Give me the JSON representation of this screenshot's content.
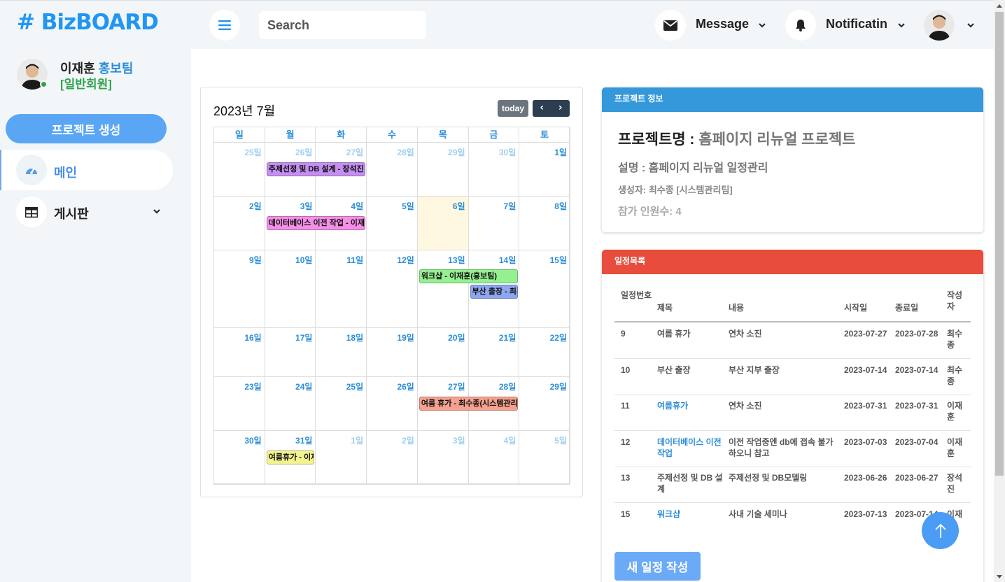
{
  "app": {
    "logo": "# BizBOARD"
  },
  "header": {
    "search_placeholder": "Search",
    "message_label": "Message",
    "notification_label": "Notificatin"
  },
  "sidebar": {
    "user_name": "이재훈",
    "user_team": "홍보팀",
    "user_role": "[일반회원]",
    "create_button": "프로젝트 생성",
    "items": [
      {
        "label": "메인",
        "icon": "gauge-icon"
      },
      {
        "label": "게시판",
        "icon": "table-icon"
      }
    ]
  },
  "calendar": {
    "title": "2023년 7월",
    "today_label": "today",
    "prev_label": "‹",
    "next_label": "›",
    "weekdays": [
      "일",
      "월",
      "화",
      "수",
      "목",
      "금",
      "토"
    ],
    "weeks": [
      [
        "25일",
        "26일",
        "27일",
        "28일",
        "29일",
        "30일",
        "1일"
      ],
      [
        "2일",
        "3일",
        "4일",
        "5일",
        "6일",
        "7일",
        "8일"
      ],
      [
        "9일",
        "10일",
        "11일",
        "12일",
        "13일",
        "14일",
        "15일"
      ],
      [
        "16일",
        "17일",
        "18일",
        "19일",
        "20일",
        "21일",
        "22일"
      ],
      [
        "23일",
        "24일",
        "25일",
        "26일",
        "27일",
        "28일",
        "29일"
      ],
      [
        "30일",
        "31일",
        "1일",
        "2일",
        "3일",
        "4일",
        "5일"
      ]
    ],
    "highlight_color": "#fff8e1",
    "events": [
      {
        "label": "주제선정 및 DB 설계 - 장석진",
        "color": "#c48ff0"
      },
      {
        "label": "데이터베이스 이전 작업 - 이재훈",
        "color": "#f48fe6"
      },
      {
        "label": "워크샵 - 이재훈(홍보팀)",
        "color": "#95f08f"
      },
      {
        "label": "부산 출장 - 최수종",
        "color": "#8fa7f0"
      },
      {
        "label": "여름 휴가 - 최수종(시스템관리팀)",
        "color": "#f5a18f"
      },
      {
        "label": "여름휴가 - 이재훈",
        "color": "#f3f38f"
      }
    ]
  },
  "project_info": {
    "header": "프로젝트 정보",
    "header_color": "#3498db",
    "name_label": "프로젝트명 : ",
    "name_value": "홈페이지 리뉴얼 프로젝트",
    "desc": "설명 : 홈페이지 리뉴얼 일정관리",
    "creator": "생성자: 최수종 [시스템관리팀]",
    "members": "참가 인원수: 4"
  },
  "schedule": {
    "header": "일정목록",
    "header_color": "#e74c3c",
    "columns": [
      "일정번호",
      "제목",
      "내용",
      "시작일",
      "종료일",
      "작성자"
    ],
    "rows": [
      {
        "id": "9",
        "title": "여름 휴가",
        "content": "연차 소진",
        "start": "2023-07-27",
        "end": "2023-07-28",
        "author": "최수종",
        "link": false
      },
      {
        "id": "10",
        "title": "부산 출장",
        "content": "부산 지부 출장",
        "start": "2023-07-14",
        "end": "2023-07-14",
        "author": "최수종",
        "link": false
      },
      {
        "id": "11",
        "title": "여름휴가",
        "content": "연차 소진",
        "start": "2023-07-31",
        "end": "2023-07-31",
        "author": "이재훈",
        "link": true
      },
      {
        "id": "12",
        "title": "데이터베이스 이전 작업",
        "content": "이전 작업중엔 db에 접속 불가하오니 참고",
        "start": "2023-07-03",
        "end": "2023-07-04",
        "author": "이재훈",
        "link": true
      },
      {
        "id": "13",
        "title": "주제선정 및 DB 설계",
        "content": "주제선정 및 DB모델링",
        "start": "2023-06-26",
        "end": "2023-06-27",
        "author": "장석진",
        "link": false
      },
      {
        "id": "15",
        "title": "워크샵",
        "content": "사내 기술 세미나",
        "start": "2023-07-13",
        "end": "2023-07-14",
        "author": "이재훈",
        "link": true
      }
    ],
    "new_button": "새 일정 작성"
  }
}
